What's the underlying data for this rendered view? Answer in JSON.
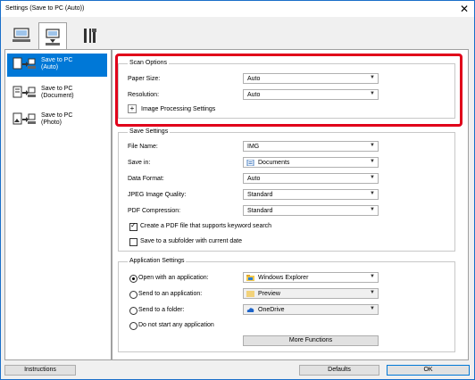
{
  "window": {
    "title": "Settings (Save to PC (Auto))"
  },
  "tabs": [
    {
      "icon": "computer-scan-icon"
    },
    {
      "icon": "scanner-to-pc-icon"
    },
    {
      "icon": "tools-icon"
    }
  ],
  "sidebar": {
    "items": [
      {
        "label": "Save to PC\n(Auto)",
        "selected": true
      },
      {
        "label": "Save to PC\n(Document)",
        "selected": false
      },
      {
        "label": "Save to PC\n(Photo)",
        "selected": false
      }
    ]
  },
  "scan_options": {
    "title": "Scan Options",
    "paper_size_label": "Paper Size:",
    "paper_size_value": "Auto",
    "resolution_label": "Resolution:",
    "resolution_value": "Auto",
    "image_processing_label": "Image Processing Settings"
  },
  "save_settings": {
    "title": "Save Settings",
    "file_name_label": "File Name:",
    "file_name_value": "IMG",
    "save_in_label": "Save in:",
    "save_in_value": "Documents",
    "data_format_label": "Data Format:",
    "data_format_value": "Auto",
    "jpeg_quality_label": "JPEG Image Quality:",
    "jpeg_quality_value": "Standard",
    "pdf_compression_label": "PDF Compression:",
    "pdf_compression_value": "Standard",
    "keyword_search_label": "Create a PDF file that supports keyword search",
    "keyword_search_checked": true,
    "subfolder_label": "Save to a subfolder with current date",
    "subfolder_checked": false
  },
  "app_settings": {
    "title": "Application Settings",
    "open_with_label": "Open with an application:",
    "open_with_value": "Windows Explorer",
    "send_to_app_label": "Send to an application:",
    "send_to_app_value": "Preview",
    "send_to_folder_label": "Send to a folder:",
    "send_to_folder_value": "OneDrive",
    "none_label": "Do not start any application",
    "selected": "open_with",
    "more_functions_label": "More Functions"
  },
  "buttons": {
    "instructions": "Instructions",
    "defaults": "Defaults",
    "ok": "OK"
  },
  "colors": {
    "accent": "#0078d7",
    "highlight_border": "#e0001a"
  }
}
